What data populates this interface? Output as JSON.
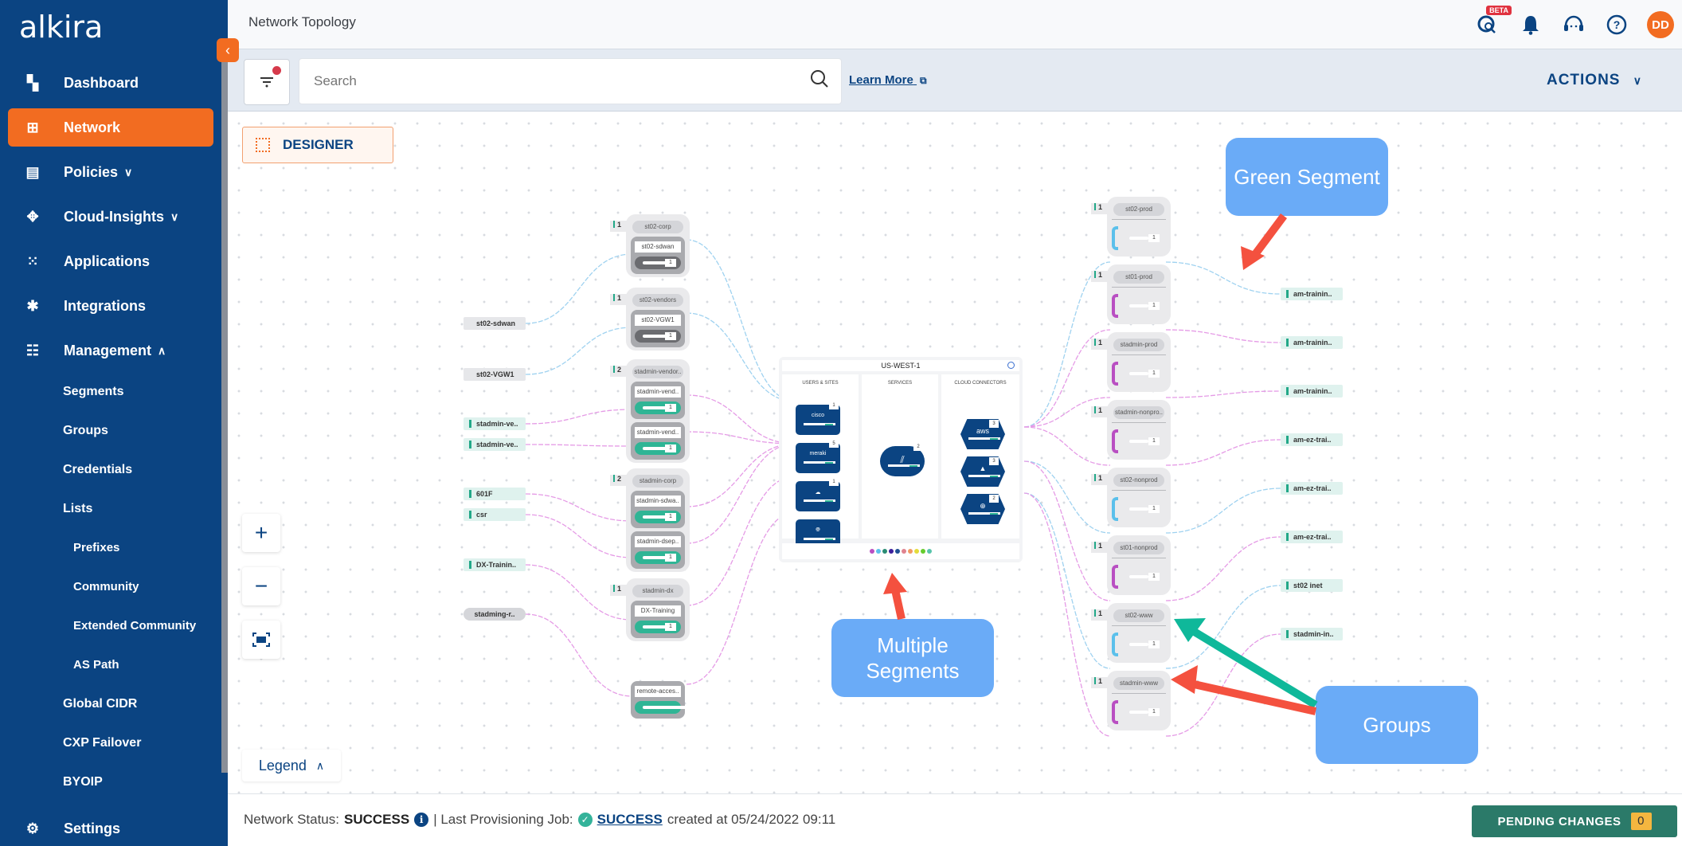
{
  "app": {
    "logo": "alkira"
  },
  "sidebar": {
    "items": [
      {
        "label": "Dashboard",
        "icon": "dashboard-icon"
      },
      {
        "label": "Network",
        "icon": "network-icon",
        "active": true
      },
      {
        "label": "Policies",
        "icon": "document-icon",
        "chevron": "down"
      },
      {
        "label": "Cloud-Insights",
        "icon": "cloud-insights-icon",
        "chevron": "down"
      },
      {
        "label": "Applications",
        "icon": "grid-icon"
      },
      {
        "label": "Integrations",
        "icon": "puzzle-icon"
      },
      {
        "label": "Management",
        "icon": "sliders-icon",
        "chevron": "up"
      }
    ],
    "subitems": [
      "Segments",
      "Groups",
      "Credentials",
      "Lists"
    ],
    "list_subitems": [
      "Prefixes",
      "Community",
      "Extended Community",
      "AS Path"
    ],
    "more_subitems": [
      "Global CIDR",
      "CXP Failover",
      "BYOIP"
    ],
    "settings": {
      "label": "Settings",
      "icon": "gear-icon"
    }
  },
  "header": {
    "title": "Network Topology",
    "beta_badge": "BETA",
    "avatar_initials": "DD"
  },
  "toolbar": {
    "search_placeholder": "Search",
    "learn_more": "Learn More",
    "actions": "ACTIONS"
  },
  "canvas": {
    "designer_label": "DESIGNER",
    "legend_label": "Legend",
    "left_endpoints": [
      {
        "label": "st02-sdwan",
        "style": "grey"
      },
      {
        "label": "st02-VGW1",
        "style": "grey"
      },
      {
        "label": "stadmin-ve..",
        "style": "green"
      },
      {
        "label": "stadmin-ve..",
        "style": "green"
      },
      {
        "label": "601F",
        "style": "green"
      },
      {
        "label": "csr",
        "style": "green"
      },
      {
        "label": "DX-Trainin..",
        "style": "green"
      },
      {
        "label": "stadming-r..",
        "style": "round"
      }
    ],
    "left_groups": [
      {
        "title": "st02-corp",
        "count": "1",
        "connectors": [
          {
            "name": "st02-sdwan",
            "num": "1",
            "style": "dark"
          }
        ]
      },
      {
        "title": "st02-vendors",
        "count": "1",
        "connectors": [
          {
            "name": "st02-VGW1",
            "num": "1",
            "style": "dark"
          }
        ]
      },
      {
        "title": "stadmin-vendor..",
        "count": "2",
        "connectors": [
          {
            "name": "stadmin-vend..",
            "num": "1",
            "style": "teal"
          },
          {
            "name": "stadmin-vend..",
            "num": "1",
            "style": "teal"
          }
        ]
      },
      {
        "title": "stadmin-corp",
        "count": "2",
        "connectors": [
          {
            "name": "stadmin-sdwa..",
            "num": "1",
            "style": "teal"
          },
          {
            "name": "stadmin-dsep..",
            "num": "1",
            "style": "teal"
          }
        ]
      },
      {
        "title": "stadmin-dx",
        "count": "1",
        "connectors": [
          {
            "name": "DX-Training",
            "num": "1",
            "style": "teal"
          }
        ]
      },
      {
        "title": "",
        "count": "",
        "connectors": [
          {
            "name": "remote-acces..",
            "num": "",
            "style": "teal"
          }
        ]
      }
    ],
    "region": {
      "title": "US-WEST-1",
      "columns": [
        "USERS & SITES",
        "SERVICES",
        "CLOUD CONNECTORS"
      ],
      "users_sites": [
        {
          "icon": "cisco-icon",
          "count": "1"
        },
        {
          "icon": "meraki-icon",
          "count": "5"
        },
        {
          "icon": "remote-access-icon",
          "count": "1"
        },
        {
          "icon": "internet-icon",
          "count": ""
        }
      ],
      "services": [
        {
          "icon": "palo-alto-icon",
          "count": "2"
        }
      ],
      "cloud_connectors": [
        {
          "icon": "aws-icon",
          "count": "3"
        },
        {
          "icon": "azure-icon",
          "count": "3"
        },
        {
          "icon": "internet-exit-icon",
          "count": "2"
        }
      ],
      "segment_colors": [
        "#b94fc2",
        "#5bc0eb",
        "#2a8c74",
        "#3d1f9c",
        "#1f4f94",
        "#e0838f",
        "#f29a63",
        "#e4dc3a",
        "#66cc2e",
        "#57c4ab"
      ]
    },
    "right_groups": [
      {
        "title": "st02-prod",
        "count": "1",
        "num": "1",
        "color": "#5bc0eb"
      },
      {
        "title": "st01-prod",
        "count": "1",
        "num": "1",
        "color": "#b94fc2"
      },
      {
        "title": "stadmin-prod",
        "count": "1",
        "num": "1",
        "color": "#b94fc2"
      },
      {
        "title": "stadmin-nonpro..",
        "count": "1",
        "num": "1",
        "color": "#b94fc2"
      },
      {
        "title": "st02-nonprod",
        "count": "1",
        "num": "1",
        "color": "#5bc0eb"
      },
      {
        "title": "st01-nonprod",
        "count": "1",
        "num": "1",
        "color": "#b94fc2"
      },
      {
        "title": "st02-www",
        "count": "1",
        "num": "1",
        "color": "#5bc0eb"
      },
      {
        "title": "stadmin-www",
        "count": "1",
        "num": "1",
        "color": "#b94fc2"
      }
    ],
    "right_endpoints": [
      "am-trainin..",
      "am-trainin..",
      "am-trainin..",
      "am-ez-trai..",
      "am-ez-trai..",
      "am-ez-trai..",
      "st02 inet",
      "stadmin-in.."
    ],
    "annotations": {
      "green_segment": "Green Segment",
      "multiple_segments": "Multiple Segments",
      "groups": "Groups"
    }
  },
  "status": {
    "network_status_label": "Network Status:",
    "network_status_value": "SUCCESS",
    "last_job_label": "| Last Provisioning Job:",
    "last_job_value": "SUCCESS",
    "created_text": "created at 05/24/2022 09:11",
    "pending_label": "PENDING CHANGES",
    "pending_count": "0"
  }
}
